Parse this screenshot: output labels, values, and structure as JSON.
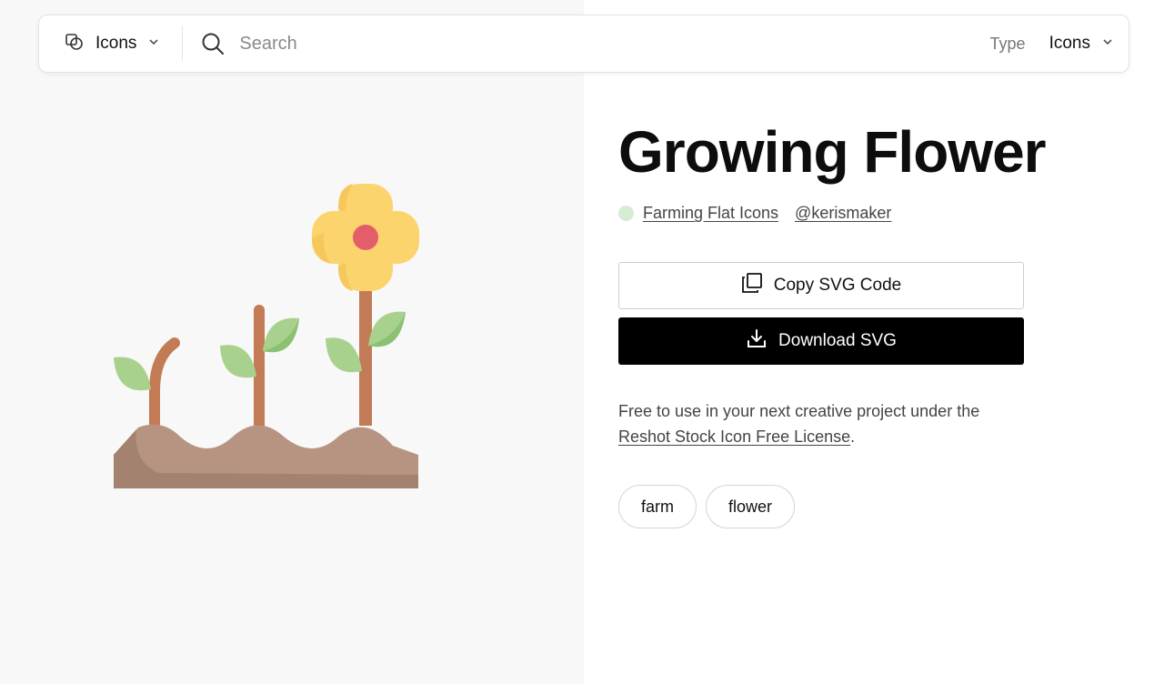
{
  "search": {
    "scope_label": "Icons",
    "placeholder": "Search",
    "type_label": "Type",
    "type_value": "Icons"
  },
  "icon": {
    "title": "Growing Flower",
    "set_name": "Farming Flat Icons",
    "author": "@kerismaker",
    "colors": {
      "petal": "#fbd46d",
      "petal_shade": "#f6c75a",
      "center": "#e35d6a",
      "stem": "#c37b55",
      "leaf": "#a9d18e",
      "leaf_shade": "#8cc072",
      "soil": "#b79482",
      "soil_shade": "#a38370"
    }
  },
  "actions": {
    "copy_label": "Copy SVG Code",
    "download_label": "Download SVG"
  },
  "license": {
    "text": "Free to use in your next creative project under the",
    "link": "Reshot Stock Icon Free License",
    "suffix": "."
  },
  "tags": [
    "farm",
    "flower"
  ]
}
